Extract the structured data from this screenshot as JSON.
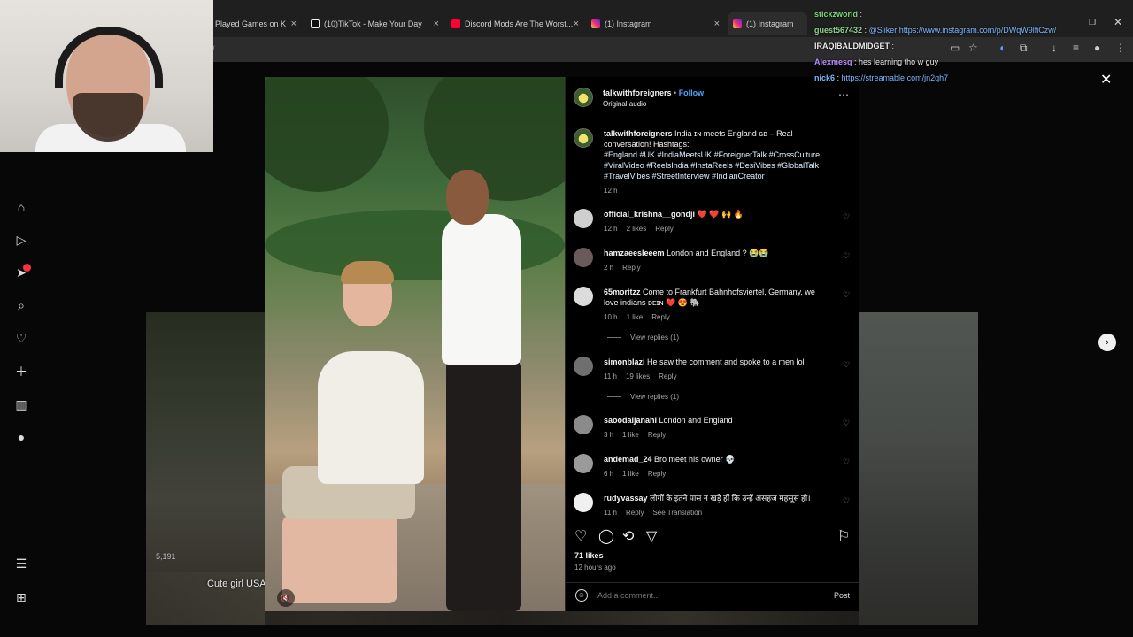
{
  "browser": {
    "tabs": [
      {
        "label": "Played Games on K",
        "icon_color": "#53fc18"
      },
      {
        "label": "(10)TikTok - Make Your Day",
        "icon_color": "#ffffff"
      },
      {
        "label": "Discord Mods Are The Worst...",
        "icon_color": "#ff0033"
      },
      {
        "label": "(1) Instagram",
        "icon_color": "#e1306c"
      },
      {
        "label": "(1) Instagram",
        "icon_color": "#e1306c"
      }
    ],
    "address": "/"
  },
  "chat": [
    {
      "user": "stickzworld",
      "color": "#7ad67a",
      "message": ""
    },
    {
      "user": "guest567432",
      "color": "#8fd48f",
      "message": "@Sliker https://www.instagram.com/p/DWqW9lfiCzw/"
    },
    {
      "user": "IRAQIBALDMIDGET",
      "color": "#e8e8e8",
      "message": ""
    },
    {
      "user": "Alexmesq",
      "color": "#b98cff",
      "message": "hes learning tho w guy"
    },
    {
      "user": "nick6",
      "color": "#7db7ff",
      "message": "https://streamable.com/jn2qh7"
    }
  ],
  "post": {
    "author": "talkwithforeigners",
    "follow_label": "Follow",
    "audio": "Original audio",
    "caption_text": "India ɪɴ meets England ɢʙ – Real conversation! Hashtags:",
    "caption_tags": "#England #UK #IndiaMeetsUK #ForeignerTalk #CrossCulture #ViralVideo #ReelsIndia #InstaReels #DesiVibes #GlobalTalk #TravelVibes #StreetInterview #IndianCreator",
    "caption_time": "12 h",
    "likes": "71 likes",
    "posted_ago": "12 hours ago",
    "comment_placeholder": "Add a comment...",
    "post_label": "Post"
  },
  "comments": [
    {
      "user": "official_krishna__gondji",
      "text": "❤️ ❤️ 🙌 🔥",
      "time": "12 h",
      "likes": "2 likes",
      "reply": "Reply",
      "extra": ""
    },
    {
      "user": "hamzaeesleeem",
      "text": "London and England ? 😭😭",
      "time": "2 h",
      "likes": "",
      "reply": "Reply",
      "extra": ""
    },
    {
      "user": "65moritzz",
      "text": "Come to Frankfurt Bahnhofsviertel, Germany, we love indians ᴅᴇɪɴ ❤️ 😍 🐘",
      "time": "10 h",
      "likes": "1 like",
      "reply": "Reply",
      "extra": ""
    },
    {
      "user": "simonblazi",
      "text": "He saw the comment and spoke to a men lol",
      "time": "11 h",
      "likes": "19 likes",
      "reply": "Reply",
      "extra": ""
    },
    {
      "user": "saoodaljanahi",
      "text": "London and England",
      "time": "3 h",
      "likes": "1 like",
      "reply": "Reply",
      "extra": ""
    },
    {
      "user": "andemad_24",
      "text": "Bro meet his owner 💀",
      "time": "6 h",
      "likes": "1 like",
      "reply": "Reply",
      "extra": ""
    },
    {
      "user": "rudyvassay",
      "text": "लोगों के इतने पास न खड़े हों कि उन्हें असहज महसूस हो।",
      "time": "11 h",
      "likes": "",
      "reply": "Reply",
      "extra": "See Translation"
    }
  ],
  "view_replies": [
    "View replies (1)",
    "View replies (1)"
  ],
  "side_preview": {
    "label": "Cute girl USA",
    "views": "5,191"
  }
}
